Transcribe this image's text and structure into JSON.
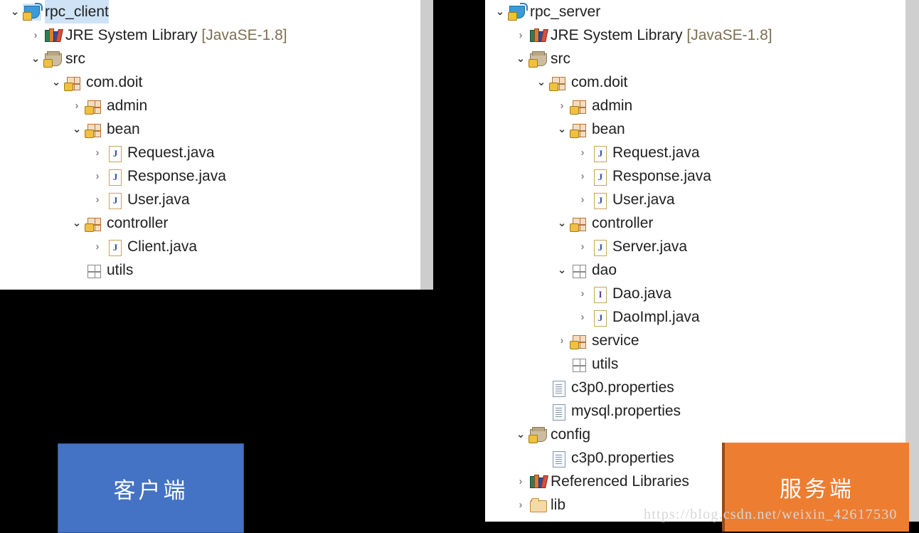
{
  "watermark": "https://blog.csdn.net/weixin_42617530",
  "colors": {
    "client_callout_bg": "#4472c4",
    "server_callout_bg": "#ed7d31",
    "selection_highlight": "#cfe3f7",
    "scrollbar": "#cdcdcd",
    "panel_bg": "#ffffff",
    "backdrop": "#000000"
  },
  "callouts": {
    "client": "客户端",
    "server": "服务端"
  },
  "client_panel": {
    "title": "rpc_client",
    "rows": [
      {
        "depth": 0,
        "twisty": "open",
        "icon": "java-project-icon",
        "label": "rpc_client",
        "suffix": "",
        "selected": true
      },
      {
        "depth": 1,
        "twisty": "closed",
        "icon": "java-library-icon",
        "label": "JRE System Library ",
        "suffix": "[JavaSE-1.8]",
        "selected": false
      },
      {
        "depth": 1,
        "twisty": "open",
        "icon": "source-folder-icon",
        "label": "src",
        "suffix": "",
        "selected": false
      },
      {
        "depth": 2,
        "twisty": "open",
        "icon": "package-icon",
        "label": "com.doit",
        "suffix": "",
        "selected": false
      },
      {
        "depth": 3,
        "twisty": "closed",
        "icon": "package-icon",
        "label": "admin",
        "suffix": "",
        "selected": false
      },
      {
        "depth": 3,
        "twisty": "open",
        "icon": "package-icon",
        "label": "bean",
        "suffix": "",
        "selected": false
      },
      {
        "depth": 4,
        "twisty": "closed",
        "icon": "java-class-icon",
        "label": "Request.java",
        "suffix": "",
        "selected": false
      },
      {
        "depth": 4,
        "twisty": "closed",
        "icon": "java-class-icon",
        "label": "Response.java",
        "suffix": "",
        "selected": false
      },
      {
        "depth": 4,
        "twisty": "closed",
        "icon": "java-class-icon",
        "label": "User.java",
        "suffix": "",
        "selected": false
      },
      {
        "depth": 3,
        "twisty": "open",
        "icon": "package-icon",
        "label": "controller",
        "suffix": "",
        "selected": false
      },
      {
        "depth": 4,
        "twisty": "closed",
        "icon": "java-class-icon",
        "label": "Client.java",
        "suffix": "",
        "selected": false
      },
      {
        "depth": 3,
        "twisty": "none",
        "icon": "empty-package-icon",
        "label": "utils",
        "suffix": "",
        "selected": false
      }
    ]
  },
  "server_panel": {
    "title": "rpc_server",
    "rows": [
      {
        "depth": 0,
        "twisty": "open",
        "icon": "java-project-icon",
        "label": "rpc_server",
        "suffix": "",
        "selected": false
      },
      {
        "depth": 1,
        "twisty": "closed",
        "icon": "java-library-icon",
        "label": "JRE System Library ",
        "suffix": "[JavaSE-1.8]",
        "selected": false
      },
      {
        "depth": 1,
        "twisty": "open",
        "icon": "source-folder-icon",
        "label": "src",
        "suffix": "",
        "selected": false
      },
      {
        "depth": 2,
        "twisty": "open",
        "icon": "package-icon",
        "label": "com.doit",
        "suffix": "",
        "selected": false
      },
      {
        "depth": 3,
        "twisty": "closed",
        "icon": "package-icon",
        "label": "admin",
        "suffix": "",
        "selected": false
      },
      {
        "depth": 3,
        "twisty": "open",
        "icon": "package-icon",
        "label": "bean",
        "suffix": "",
        "selected": false
      },
      {
        "depth": 4,
        "twisty": "closed",
        "icon": "java-class-icon",
        "label": "Request.java",
        "suffix": "",
        "selected": false
      },
      {
        "depth": 4,
        "twisty": "closed",
        "icon": "java-class-icon",
        "label": "Response.java",
        "suffix": "",
        "selected": false
      },
      {
        "depth": 4,
        "twisty": "closed",
        "icon": "java-class-icon",
        "label": "User.java",
        "suffix": "",
        "selected": false
      },
      {
        "depth": 3,
        "twisty": "open",
        "icon": "package-icon",
        "label": "controller",
        "suffix": "",
        "selected": false
      },
      {
        "depth": 4,
        "twisty": "closed",
        "icon": "java-class-icon",
        "label": "Server.java",
        "suffix": "",
        "selected": false
      },
      {
        "depth": 3,
        "twisty": "open",
        "icon": "empty-package-icon",
        "label": "dao",
        "suffix": "",
        "selected": false
      },
      {
        "depth": 4,
        "twisty": "closed",
        "icon": "java-interface-icon",
        "label": "Dao.java",
        "suffix": "",
        "selected": false
      },
      {
        "depth": 4,
        "twisty": "closed",
        "icon": "java-class-icon",
        "label": "DaoImpl.java",
        "suffix": "",
        "selected": false
      },
      {
        "depth": 3,
        "twisty": "closed",
        "icon": "package-icon",
        "label": "service",
        "suffix": "",
        "selected": false
      },
      {
        "depth": 3,
        "twisty": "none",
        "icon": "empty-package-icon",
        "label": "utils",
        "suffix": "",
        "selected": false
      },
      {
        "depth": 2,
        "twisty": "none",
        "icon": "properties-file-icon",
        "label": "c3p0.properties",
        "suffix": "",
        "selected": false
      },
      {
        "depth": 2,
        "twisty": "none",
        "icon": "properties-file-icon",
        "label": "mysql.properties",
        "suffix": "",
        "selected": false
      },
      {
        "depth": 1,
        "twisty": "open",
        "icon": "source-folder-icon",
        "label": "config",
        "suffix": "",
        "selected": false
      },
      {
        "depth": 2,
        "twisty": "none",
        "icon": "properties-file-icon",
        "label": "c3p0.properties",
        "suffix": "",
        "selected": false
      },
      {
        "depth": 1,
        "twisty": "closed",
        "icon": "java-library-icon",
        "label": "Referenced Libraries",
        "suffix": "",
        "selected": false
      },
      {
        "depth": 1,
        "twisty": "closed",
        "icon": "folder-icon",
        "label": "lib",
        "suffix": "",
        "selected": false
      }
    ]
  }
}
